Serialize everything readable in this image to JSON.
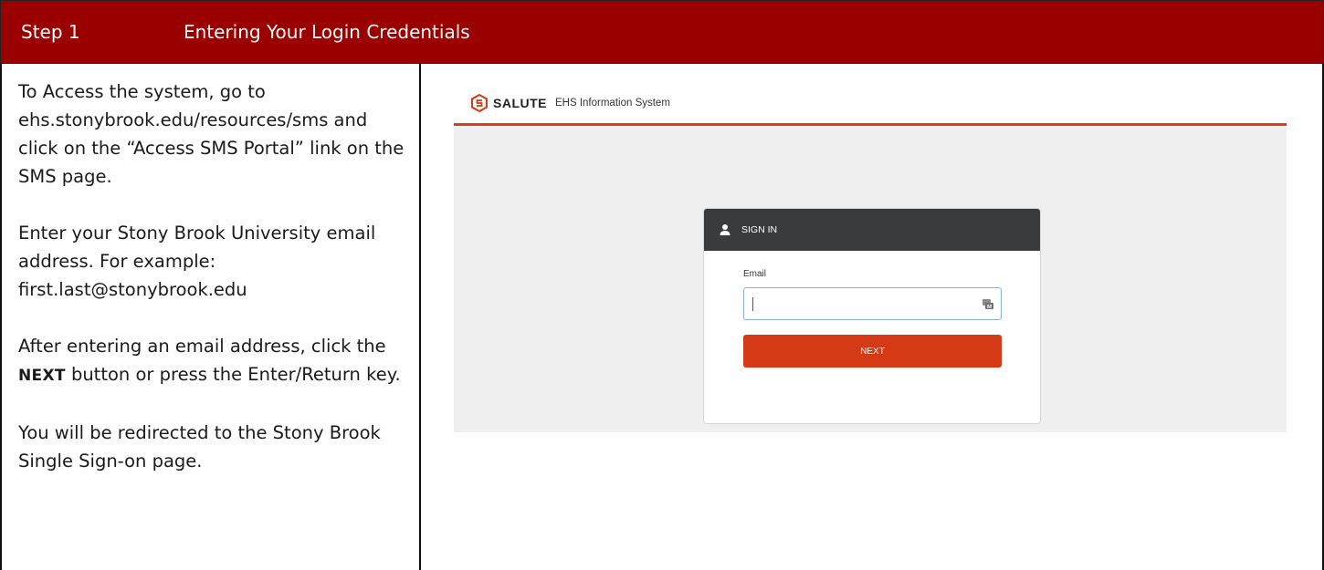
{
  "header": {
    "step_label": "Step 1",
    "title": "Entering Your Login Credentials"
  },
  "instructions": {
    "p1": "To Access the system, go to ehs.stonybrook.edu/resources/sms and click on the “Access SMS Portal” link on the SMS page.",
    "p2": "Enter your Stony Brook University email address. For example: first.last@stonybrook.edu",
    "p3_before": "After entering an email address, click the ",
    "p3_bold": "Next",
    "p3_after": " button or press the Enter/Return key.",
    "p4": "You will be redirected to the Stony Brook Single Sign-on page."
  },
  "screenshot": {
    "logo_text": "SALUTE",
    "logo_subtitle": "EHS Information System",
    "card_title": "SIGN IN",
    "email_label": "Email",
    "email_value": "",
    "next_label": "NEXT",
    "icons": {
      "logo": "salute-logo-icon",
      "user": "user-icon",
      "keyboard": "keyboard-icon"
    },
    "colors": {
      "accent": "#d53a17",
      "header_dark": "#3a3b3d",
      "doc_header": "#9b0000"
    }
  }
}
